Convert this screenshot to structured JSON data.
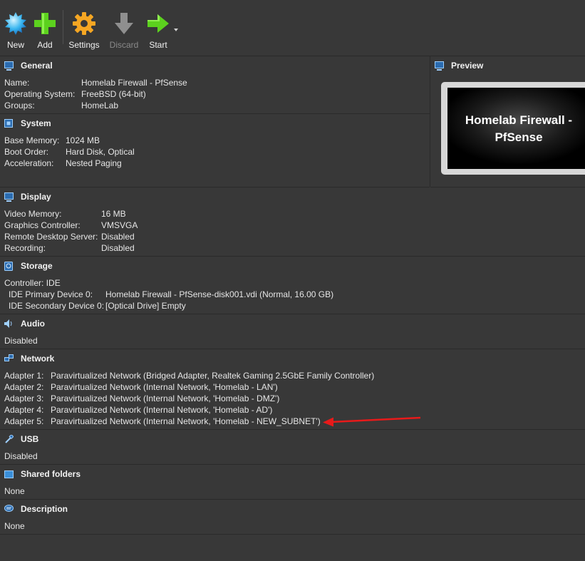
{
  "toolbar": {
    "new_label": "New",
    "add_label": "Add",
    "settings_label": "Settings",
    "discard_label": "Discard",
    "start_label": "Start"
  },
  "general": {
    "title": "General",
    "name_k": "Name:",
    "name_v": "Homelab Firewall - PfSense",
    "os_k": "Operating System:",
    "os_v": "FreeBSD (64-bit)",
    "groups_k": "Groups:",
    "groups_v": "HomeLab"
  },
  "preview": {
    "title": "Preview",
    "line1": "Homelab Firewall -",
    "line2": "PfSense"
  },
  "system": {
    "title": "System",
    "mem_k": "Base Memory:",
    "mem_v": "1024 MB",
    "boot_k": "Boot Order:",
    "boot_v": "Hard Disk, Optical",
    "accel_k": "Acceleration:",
    "accel_v": "Nested Paging"
  },
  "display": {
    "title": "Display",
    "vmem_k": "Video Memory:",
    "vmem_v": "16 MB",
    "gfx_k": "Graphics Controller:",
    "gfx_v": "VMSVGA",
    "rds_k": "Remote Desktop Server:",
    "rds_v": "Disabled",
    "rec_k": "Recording:",
    "rec_v": "Disabled"
  },
  "storage": {
    "title": "Storage",
    "controller": "Controller: IDE",
    "primary_k": "IDE Primary Device 0:",
    "primary_v": "Homelab Firewall - PfSense-disk001.vdi (Normal, 16.00 GB)",
    "secondary_k": "IDE Secondary Device 0:",
    "secondary_v": "[Optical Drive] Empty"
  },
  "audio": {
    "title": "Audio",
    "value": "Disabled"
  },
  "network": {
    "title": "Network",
    "adapters": [
      {
        "k": "Adapter 1:",
        "v": "Paravirtualized Network (Bridged Adapter, Realtek Gaming 2.5GbE Family Controller)"
      },
      {
        "k": "Adapter 2:",
        "v": "Paravirtualized Network (Internal Network, 'Homelab - LAN')"
      },
      {
        "k": "Adapter 3:",
        "v": "Paravirtualized Network (Internal Network, 'Homelab - DMZ')"
      },
      {
        "k": "Adapter 4:",
        "v": "Paravirtualized Network (Internal Network, 'Homelab - AD')"
      },
      {
        "k": "Adapter 5:",
        "v": "Paravirtualized Network (Internal Network, 'Homelab - NEW_SUBNET')"
      }
    ]
  },
  "usb": {
    "title": "USB",
    "value": "Disabled"
  },
  "shared": {
    "title": "Shared folders",
    "value": "None"
  },
  "description": {
    "title": "Description",
    "value": "None"
  },
  "colors": {
    "annotation_arrow": "#e81a1a"
  }
}
